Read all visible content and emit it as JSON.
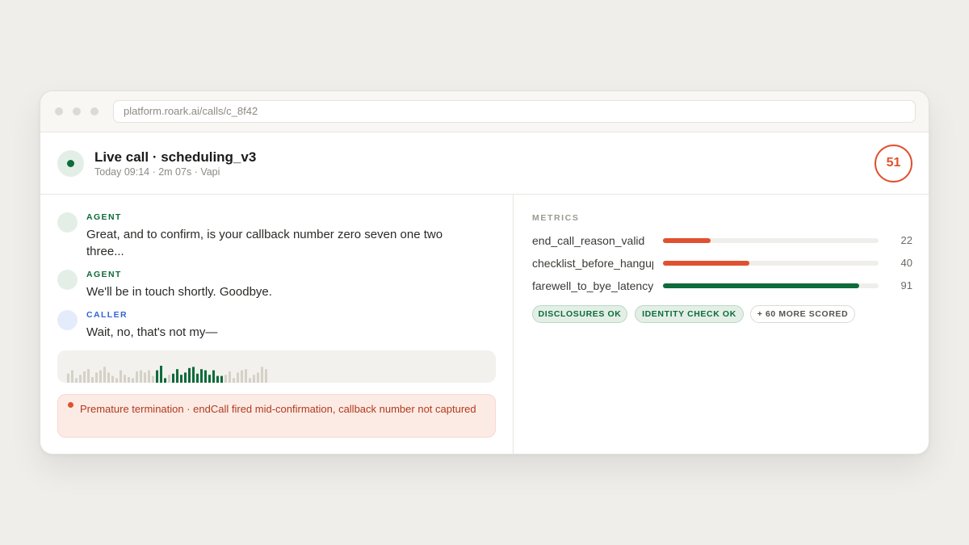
{
  "browser": {
    "url": "platform.roark.ai/calls/c_8f42"
  },
  "call": {
    "title": "Live call · scheduling_v3",
    "subtitle": "Today 09:14 · 2m 07s · Vapi",
    "score": "51"
  },
  "transcript": [
    {
      "role": "AGENT",
      "text": "Great, and to confirm, is your callback number zero seven one two three..."
    },
    {
      "role": "AGENT",
      "text": "We'll be in touch shortly. Goodbye."
    },
    {
      "role": "CALLER",
      "text": "Wait, no, that's not my—"
    }
  ],
  "waveform": {
    "inactive_color": "#d6d1c7",
    "active_color": "#0e6b3a",
    "levels": [
      0.4,
      0.55,
      0.2,
      0.35,
      0.5,
      0.6,
      0.25,
      0.45,
      0.55,
      0.7,
      0.45,
      0.3,
      0.2,
      0.55,
      0.35,
      0.25,
      0.2,
      0.5,
      0.55,
      0.45,
      0.55,
      0.3,
      0.55,
      0.75,
      0.2,
      0.35,
      0.4,
      0.6,
      0.35,
      0.45,
      0.65,
      0.7,
      0.4,
      0.6,
      0.55,
      0.35,
      0.55,
      0.3,
      0.3,
      0.35,
      0.5,
      0.2,
      0.45,
      0.55,
      0.6,
      0.2,
      0.35,
      0.45,
      0.7,
      0.6
    ],
    "active": [
      22,
      23,
      24,
      26,
      27,
      28,
      29,
      30,
      31,
      32,
      33,
      34,
      35,
      36,
      37,
      38
    ]
  },
  "alert": {
    "text": "Premature termination · endCall fired mid-confirmation, callback number not captured",
    "color": "#e0512f"
  },
  "metrics": {
    "label": "METRICS",
    "items": [
      {
        "name": "end_call_reason_valid",
        "value": 22,
        "color": "#e0512f"
      },
      {
        "name": "checklist_before_hangup",
        "value": 40,
        "color": "#e0512f"
      },
      {
        "name": "farewell_to_bye_latency",
        "value": 91,
        "color": "#0e6b3a"
      }
    ],
    "tags": [
      {
        "label": "DISCLOSURES OK",
        "kind": "ok"
      },
      {
        "label": "IDENTITY CHECK OK",
        "kind": "ok"
      },
      {
        "label": "+ 60 MORE SCORED",
        "kind": "more"
      }
    ]
  }
}
